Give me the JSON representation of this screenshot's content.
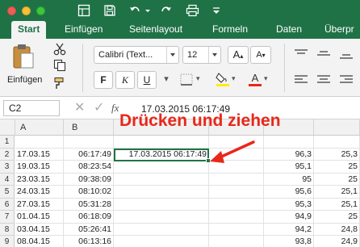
{
  "ribbon_tabs": [
    "Start",
    "Einfügen",
    "Seitenlayout",
    "Formeln",
    "Daten",
    "Überpr"
  ],
  "ribbon": {
    "paste_label": "Einfügen",
    "font_name": "Calibri (Text...",
    "font_size": "12",
    "bold": "F",
    "italic": "K",
    "underline": "U"
  },
  "formula_bar": {
    "name_box": "C2",
    "fx": "fx",
    "formula_value": "17.03.2015 06:17:49"
  },
  "columns": [
    "A",
    "B"
  ],
  "rows": [
    {
      "n": "1",
      "a": "",
      "b": "",
      "c": "",
      "e": "",
      "f": ""
    },
    {
      "n": "2",
      "a": "17.03.15",
      "b": "06:17:49",
      "c": "17.03.2015 06:17:49",
      "e": "96,3",
      "f": "25,3"
    },
    {
      "n": "3",
      "a": "19.03.15",
      "b": "08:23:54",
      "c": "",
      "e": "95,1",
      "f": "25"
    },
    {
      "n": "4",
      "a": "23.03.15",
      "b": "09:38:09",
      "c": "",
      "e": "95",
      "f": "25"
    },
    {
      "n": "5",
      "a": "24.03.15",
      "b": "08:10:02",
      "c": "",
      "e": "95,6",
      "f": "25,1"
    },
    {
      "n": "6",
      "a": "27.03.15",
      "b": "05:31:28",
      "c": "",
      "e": "95,3",
      "f": "25,1"
    },
    {
      "n": "7",
      "a": "01.04.15",
      "b": "06:18:09",
      "c": "",
      "e": "94,9",
      "f": "25"
    },
    {
      "n": "8",
      "a": "03.04.15",
      "b": "05:26:41",
      "c": "",
      "e": "94,2",
      "f": "24,8"
    },
    {
      "n": "9",
      "a": "08.04.15",
      "b": "06:13:16",
      "c": "",
      "e": "93,8",
      "f": "24,9"
    }
  ],
  "annotation": "Drücken und ziehen",
  "colors": {
    "excel_green": "#1f7246",
    "annotation_red": "#e8281a",
    "selection_green": "#217346"
  }
}
